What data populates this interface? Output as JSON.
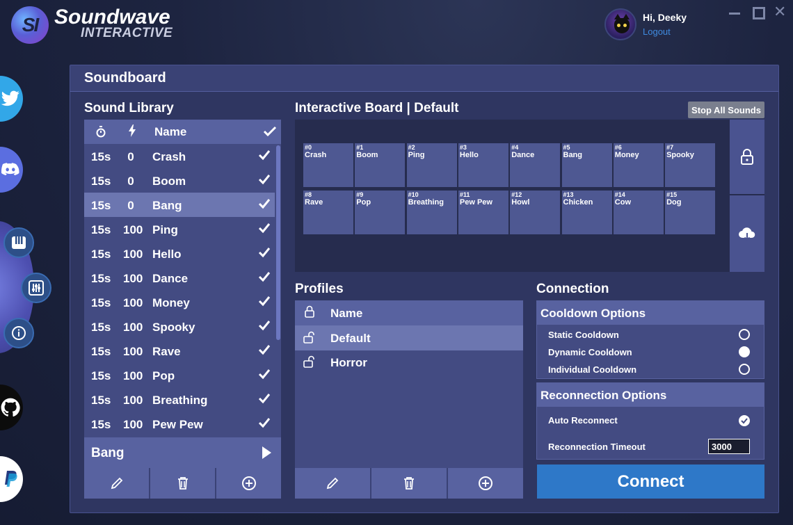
{
  "app": {
    "brand_mark": "SI",
    "brand_title": "Soundwave",
    "brand_subtitle": "INTERACTIVE"
  },
  "user": {
    "greeting": "Hi, Deeky",
    "logout": "Logout"
  },
  "window_controls": {
    "close_glyph": "✕"
  },
  "page": {
    "title": "Soundboard"
  },
  "library": {
    "title": "Sound Library",
    "headers": {
      "name": "Name"
    },
    "rows": [
      {
        "cooldown": "15s",
        "cost": "0",
        "name": "Crash"
      },
      {
        "cooldown": "15s",
        "cost": "0",
        "name": "Boom"
      },
      {
        "cooldown": "15s",
        "cost": "0",
        "name": "Bang"
      },
      {
        "cooldown": "15s",
        "cost": "100",
        "name": "Ping"
      },
      {
        "cooldown": "15s",
        "cost": "100",
        "name": "Hello"
      },
      {
        "cooldown": "15s",
        "cost": "100",
        "name": "Dance"
      },
      {
        "cooldown": "15s",
        "cost": "100",
        "name": "Money"
      },
      {
        "cooldown": "15s",
        "cost": "100",
        "name": "Spooky"
      },
      {
        "cooldown": "15s",
        "cost": "100",
        "name": "Rave"
      },
      {
        "cooldown": "15s",
        "cost": "100",
        "name": "Pop"
      },
      {
        "cooldown": "15s",
        "cost": "100",
        "name": "Breathing"
      },
      {
        "cooldown": "15s",
        "cost": "100",
        "name": "Pew Pew"
      }
    ],
    "selected_index": 2,
    "selected_sound": "Bang"
  },
  "board": {
    "title": "Interactive Board | Default",
    "stop_all": "Stop All Sounds",
    "tiles": [
      {
        "num": "#0",
        "name": "Crash"
      },
      {
        "num": "#1",
        "name": "Boom"
      },
      {
        "num": "#2",
        "name": "Ping"
      },
      {
        "num": "#3",
        "name": "Hello"
      },
      {
        "num": "#4",
        "name": "Dance"
      },
      {
        "num": "#5",
        "name": "Bang"
      },
      {
        "num": "#6",
        "name": "Money"
      },
      {
        "num": "#7",
        "name": "Spooky"
      },
      {
        "num": "#8",
        "name": "Rave"
      },
      {
        "num": "#9",
        "name": "Pop"
      },
      {
        "num": "#10",
        "name": "Breathing"
      },
      {
        "num": "#11",
        "name": "Pew Pew"
      },
      {
        "num": "#12",
        "name": "Howl"
      },
      {
        "num": "#13",
        "name": "Chicken"
      },
      {
        "num": "#14",
        "name": "Cow"
      },
      {
        "num": "#15",
        "name": "Dog"
      }
    ]
  },
  "profiles": {
    "title": "Profiles",
    "header": "Name",
    "rows": [
      {
        "name": "Default"
      },
      {
        "name": "Horror"
      }
    ],
    "selected_index": 0
  },
  "connection": {
    "title": "Connection",
    "cooldown": {
      "title": "Cooldown Options",
      "options": [
        {
          "label": "Static Cooldown",
          "selected": false
        },
        {
          "label": "Dynamic Cooldown",
          "selected": true
        },
        {
          "label": "Individual Cooldown",
          "selected": false
        }
      ]
    },
    "reconnection": {
      "title": "Reconnection Options",
      "auto_reconnect": "Auto Reconnect",
      "timeout_label": "Reconnection Timeout",
      "timeout_value": "3000"
    },
    "connect_button": "Connect"
  },
  "colors": {
    "accent": "#2e78c8",
    "panel": "#2f3661",
    "row": "#434b82",
    "header": "#5862a0",
    "selected": "#6c76b0"
  }
}
